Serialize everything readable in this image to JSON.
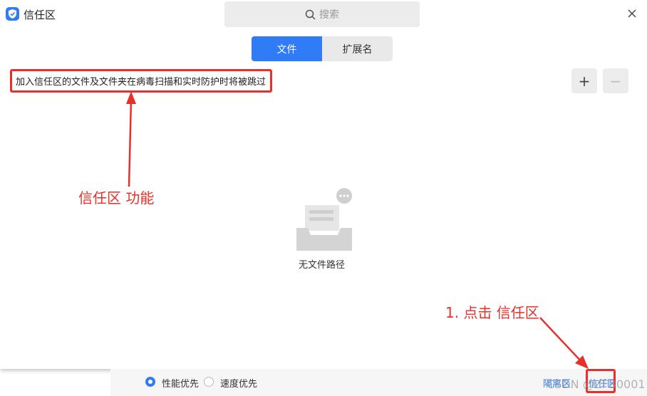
{
  "window": {
    "title": "信任区"
  },
  "search": {
    "placeholder": "搜索"
  },
  "tabs": [
    {
      "label": "文件",
      "active": true
    },
    {
      "label": "扩展名",
      "active": false
    }
  ],
  "description": "加入信任区的文件及文件夹在病毒扫描和实时防护时将被跳过",
  "buttons": {
    "add": "+",
    "remove": "−"
  },
  "empty_state": {
    "text": "无文件路径"
  },
  "annotations": {
    "feature_label": "信任区  功能",
    "step_label": "1. 点击 信任区"
  },
  "bottom_bar": {
    "options": [
      {
        "label": "性能优先",
        "selected": true
      },
      {
        "label": "速度优先",
        "selected": false
      }
    ],
    "links": {
      "quarantine": "隔离区",
      "trust_zone": "信任区"
    },
    "watermark": "CSDN @ZFB0001"
  },
  "colors": {
    "accent": "#2f7cf6",
    "annotation": "#e8302a"
  }
}
